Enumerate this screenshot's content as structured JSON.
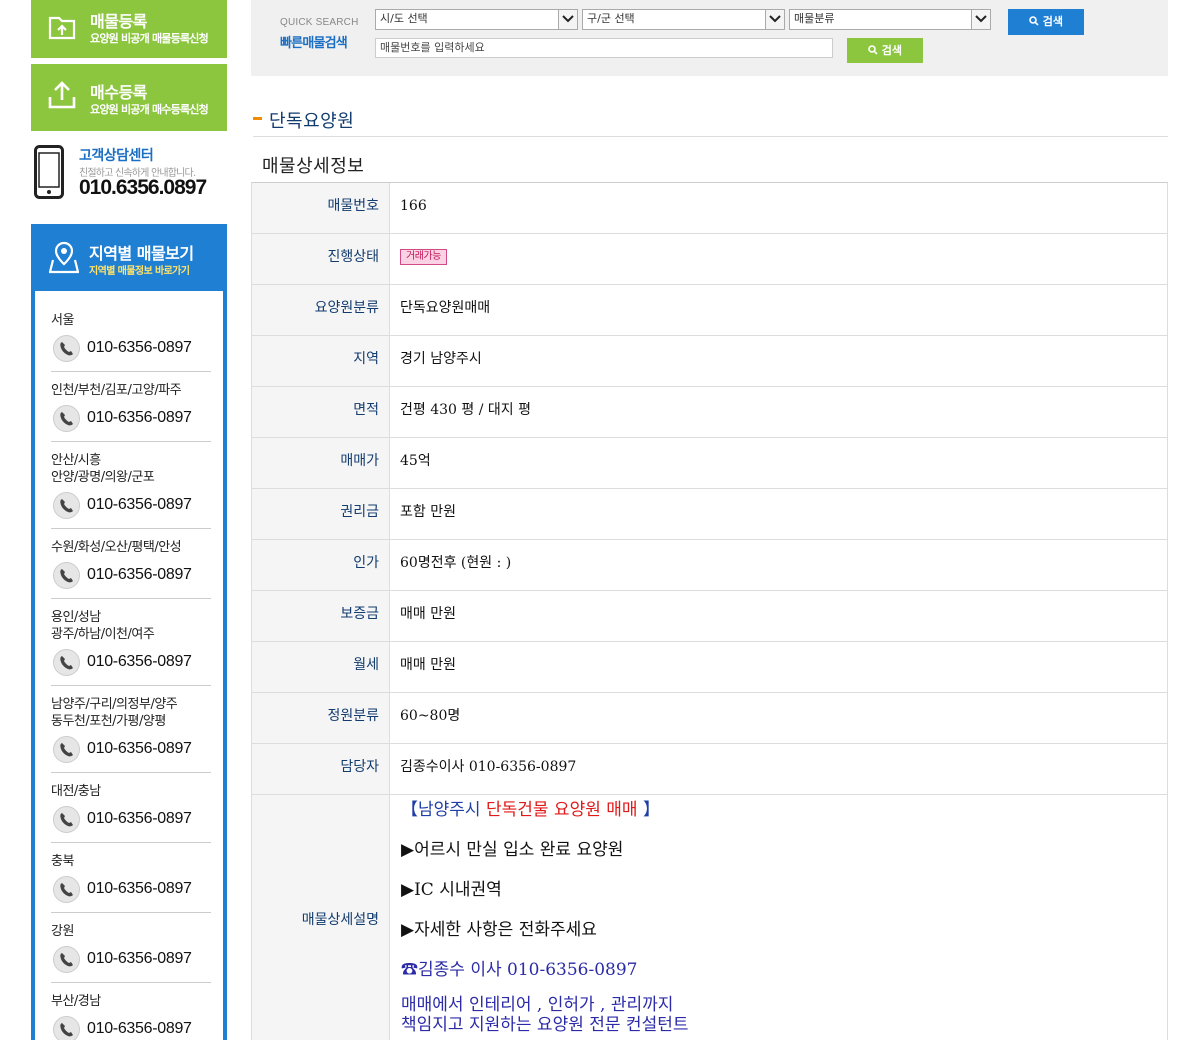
{
  "sidebar": {
    "register_listing": {
      "title": "매물등록",
      "subtitle": "요양원 비공개 매물등록신청"
    },
    "register_purchase": {
      "title": "매수등록",
      "subtitle": "요양원 비공개 매수등록신청"
    },
    "customer_center": {
      "title": "고객상담센터",
      "subtitle": "친절하고 신속하게 안내합니다.",
      "phone": "010.6356.0897"
    },
    "regions_header": {
      "title": "지역별 매물보기",
      "subtitle": "지역별 매물정보 바로가기"
    },
    "regions": [
      {
        "name": "서울",
        "phone": "010-6356-0897"
      },
      {
        "name": "인천/부천/김포/고양/파주",
        "phone": "010-6356-0897"
      },
      {
        "name": "안산/시흥\n안양/광명/의왕/군포",
        "phone": "010-6356-0897"
      },
      {
        "name": "수원/화성/오산/평택/안성",
        "phone": "010-6356-0897"
      },
      {
        "name": "용인/성남\n광주/하남/이천/여주",
        "phone": "010-6356-0897"
      },
      {
        "name": "남양주/구리/의정부/양주\n동두천/포천/가평/양평",
        "phone": "010-6356-0897"
      },
      {
        "name": "대전/충남",
        "phone": "010-6356-0897"
      },
      {
        "name": "충북",
        "phone": "010-6356-0897"
      },
      {
        "name": "강원",
        "phone": "010-6356-0897"
      },
      {
        "name": "부산/경남",
        "phone": "010-6356-0897"
      }
    ]
  },
  "search": {
    "label_en": "QUICK SEARCH",
    "label_ko": "빠른매물검색",
    "select_city": "시/도 선택",
    "select_district": "구/군 선택",
    "select_category": "매물분류",
    "search_button": "검색",
    "number_placeholder": "매물번호를 입력하세요",
    "number_search_button": "검색"
  },
  "section_title": "단독요양원",
  "detail_title": "매물상세정보",
  "details": [
    {
      "label": "매물번호",
      "value": "166"
    },
    {
      "label": "진행상태",
      "value": "거래가능",
      "badge": true
    },
    {
      "label": "요양원분류",
      "value": "단독요양원매매"
    },
    {
      "label": "지역",
      "value": "경기 남양주시"
    },
    {
      "label": "면적",
      "value": "건평 430 평 / 대지 평"
    },
    {
      "label": "매매가",
      "value": "45억"
    },
    {
      "label": "권리금",
      "value": "포함 만원"
    },
    {
      "label": "인가",
      "value": "60명전후 (현원 : )"
    },
    {
      "label": "보증금",
      "value": "매매 만원"
    },
    {
      "label": "월세",
      "value": "매매 만원"
    },
    {
      "label": "정원분류",
      "value": "60~80명"
    },
    {
      "label": "담당자",
      "value": "김종수이사 010-6356-0897"
    }
  ],
  "description": {
    "label": "매물상세설명",
    "headline_open": "【남양주시 ",
    "headline_red": "단독건물 요양원 매매",
    "headline_close": " 】",
    "lines": [
      "▶어르시 만실 입소 완료 요양원",
      "▶IC 시내권역",
      "▶자세한 사항은 전화주세요"
    ],
    "contact": "☎김종수 이사 010-6356-0897",
    "consult_1": "매매에서 인테리어 , 인허가 , 관리까지",
    "consult_2": "책임지고 지원하는 요양원 전문 컨설턴트"
  },
  "colors": {
    "green": "#8cc63f",
    "blue": "#1f7fd3",
    "navy_label": "#123b6e",
    "red": "#e01919",
    "purple": "#2b2ba8"
  }
}
